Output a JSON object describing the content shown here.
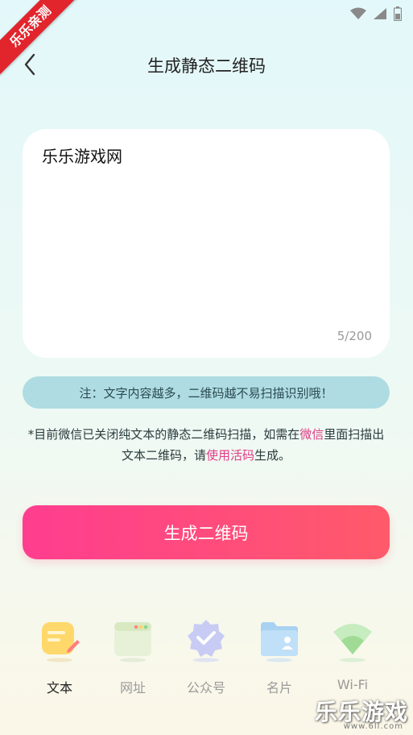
{
  "status_bar": {
    "icons": [
      "wifi-icon",
      "signal-icon",
      "battery-icon"
    ]
  },
  "corner_ribbon": {
    "text": "乐乐亲测"
  },
  "header": {
    "back_icon": "chevron-left-icon",
    "title": "生成静态二维码"
  },
  "text_card": {
    "content": "乐乐游戏网",
    "counter": "5/200"
  },
  "notice": {
    "text": "注：文字内容越多，二维码越不易扫描识别哦！"
  },
  "info": {
    "part1": "*目前微信已关闭纯文本的静态二维码扫描，如需在",
    "highlight1": "微信",
    "part2": "里面扫描出文本二维码，请",
    "highlight2": "使用活码",
    "part3": "生成。"
  },
  "generate_button": {
    "label": "生成二维码"
  },
  "bottom_nav": {
    "items": [
      {
        "label": "文本",
        "icon": "text-note-icon",
        "active": true
      },
      {
        "label": "网址",
        "icon": "browser-window-icon",
        "active": false
      },
      {
        "label": "公众号",
        "icon": "verified-badge-icon",
        "active": false
      },
      {
        "label": "名片",
        "icon": "contact-folder-icon",
        "active": false
      },
      {
        "label": "Wi-Fi",
        "icon": "wifi-icon",
        "active": false
      }
    ]
  },
  "watermark": {
    "main": "乐乐游戏",
    "sub": "www.6ll.com"
  },
  "colors": {
    "accent_pink": "#ff3d8f",
    "accent_coral": "#ff5a6a",
    "notice_bg": "#aedce2",
    "highlight": "#e23d87"
  }
}
